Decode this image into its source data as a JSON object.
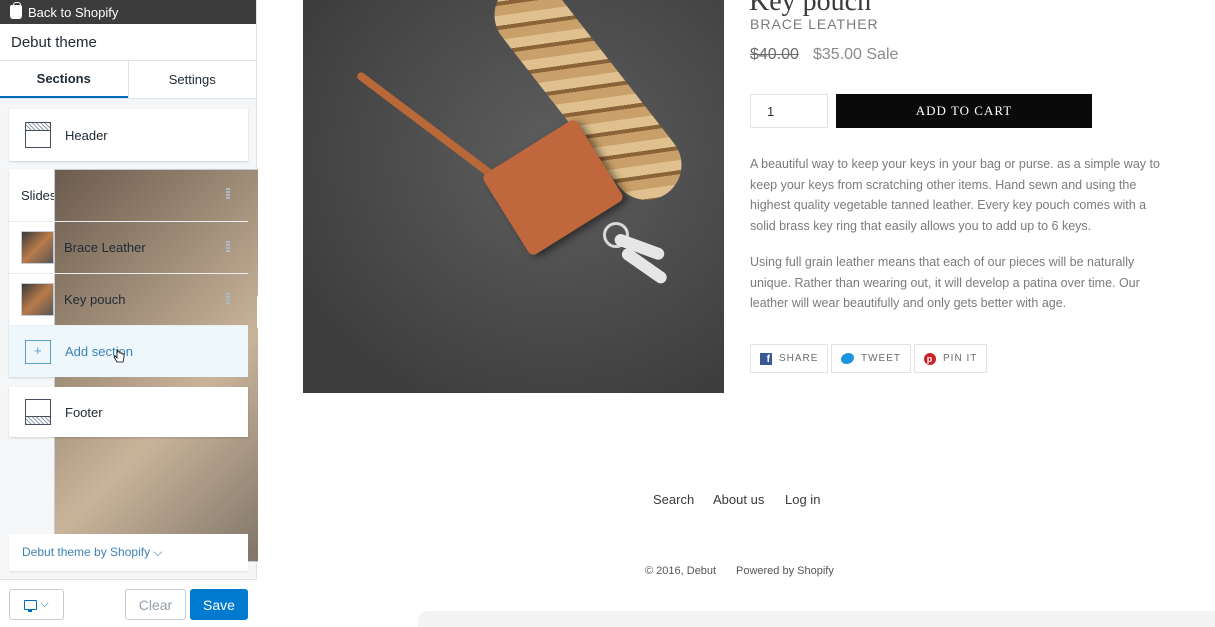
{
  "sidebar": {
    "back_label": "Back to Shopify",
    "theme_name": "Debut theme",
    "tabs": [
      {
        "label": "Sections"
      },
      {
        "label": "Settings"
      }
    ],
    "header_section": "Header",
    "sections": [
      {
        "label": "Slideshow",
        "icon": "slideshow-thumbnail"
      },
      {
        "label": "Brace Leather",
        "icon": "brace-leather-thumbnail"
      },
      {
        "label": "Key pouch",
        "icon": "key-pouch-thumbnail"
      }
    ],
    "add_section": "Add section",
    "footer_section": "Footer",
    "theme_link": "Debut theme by Shopify ⌵",
    "clear_label": "Clear",
    "save_label": "Save",
    "accent_color": "#007ace"
  },
  "product": {
    "title": "Key pouch",
    "vendor": "BRACE LEATHER",
    "price_old": "$40.00",
    "price_new": "$35.00 Sale",
    "quantity": "1",
    "add_to_cart": "ADD TO CART",
    "description_1": "A beautiful way to keep your keys in your bag or purse.  as a simple way to keep your keys from scratching other items. Hand sewn and using the highest quality vegetable tanned leather. Every key pouch comes with a solid brass key ring that easily allows you to add up to 6 keys.",
    "description_2": "Using full grain leather means that each of our pieces will be naturally unique. Rather than wearing out, it will develop a patina over time. Our leather will wear beautifully and only gets better with age.",
    "share": [
      {
        "label": "SHARE"
      },
      {
        "label": "TWEET"
      },
      {
        "label": "PIN IT"
      }
    ]
  },
  "footer": {
    "links": [
      {
        "label": "Search"
      },
      {
        "label": "About us"
      },
      {
        "label": "Log in"
      }
    ],
    "copyright": "© 2016, Debut",
    "powered": "Powered by Shopify"
  }
}
